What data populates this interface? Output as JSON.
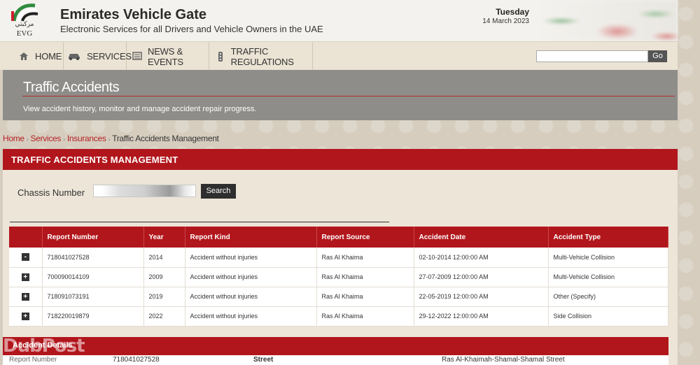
{
  "header": {
    "logo_arabic": "مركبتي",
    "logo_text": "EVG",
    "title": "Emirates Vehicle Gate",
    "subtitle": "Electronic Services for all Drivers and Vehicle Owners in the UAE",
    "date_day": "Tuesday",
    "date_full": "14 March 2023"
  },
  "nav": {
    "items": [
      {
        "label": "HOME",
        "icon": "home-icon"
      },
      {
        "label": "SERVICES",
        "icon": "car-icon"
      },
      {
        "label": "NEWS & EVENTS",
        "icon": "news-icon"
      },
      {
        "label": "TRAFFIC REGULATIONS",
        "icon": "traffic-light-icon"
      }
    ],
    "search_value": "",
    "go_label": "Go"
  },
  "banner": {
    "title": "Traffic Accidents",
    "subtitle": "View accident history, monitor and manage accident repair progress."
  },
  "breadcrumb": [
    "Home",
    "Services",
    "Insurances",
    "Traffic Accidents Management"
  ],
  "panel": {
    "title": "TRAFFIC ACCIDENTS MANAGEMENT",
    "chassis_label": "Chassis Number",
    "chassis_value": "",
    "search_label": "Search"
  },
  "table": {
    "headers": [
      "Report Number",
      "Year",
      "Report Kind",
      "Report Source",
      "Accident Date",
      "Accident Type"
    ],
    "rows": [
      {
        "toggle": "-",
        "cells": [
          "718041027528",
          "2014",
          "Accident without injuries",
          "Ras Al Khaima",
          "02-10-2014 12:00:00 AM",
          "Multi-Vehicle Collision"
        ]
      },
      {
        "toggle": "+",
        "cells": [
          "700090014109",
          "2009",
          "Accident without injuries",
          "Ras Al Khaima",
          "27-07-2009 12:00:00 AM",
          "Multi-Vehicle Collision"
        ]
      },
      {
        "toggle": "+",
        "cells": [
          "718091073191",
          "2019",
          "Accident without injuries",
          "Ras Al Khaima",
          "22-05-2019 12:00:00 AM",
          "Other (Specify)"
        ]
      },
      {
        "toggle": "+",
        "cells": [
          "718220019879",
          "2022",
          "Accident without injuries",
          "Ras Al Khaima",
          "29-12-2022 12:00:00 AM",
          "Side Collision"
        ]
      }
    ]
  },
  "details": {
    "title": "Accident Details",
    "report_number_label": "Report Number",
    "report_number_value": "718041027528",
    "street_label": "Street",
    "street_value": "Ras Al-Khaimah-Shamal-Shamal Street"
  },
  "watermark": "DubPost",
  "colors": {
    "accent_red": "#b1161c",
    "banner_gray": "#8e8d8a",
    "link_red": "#b52024"
  }
}
